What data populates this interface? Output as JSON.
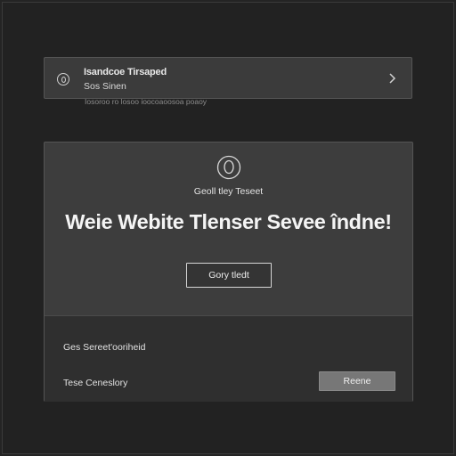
{
  "notice": {
    "title": "Isandcoe Tirsaped",
    "subtitle": "Sos Sinen",
    "caption": "Iosoroo ro losoo ioocoaoosoa poaoy",
    "icon": "info-icon",
    "chevron_icon": "chevron-right-icon"
  },
  "card": {
    "emblem_icon": "emblem-icon",
    "eyebrow": "Geoll tley Teseet",
    "headline": "Weie Webite Tlenser Sevee îndne!",
    "cta_label": "Gory tledt"
  },
  "panel": {
    "line1": "Ges Sereet'ooriheid",
    "line2": "Tese Ceneslory",
    "button_label": "Reene"
  }
}
